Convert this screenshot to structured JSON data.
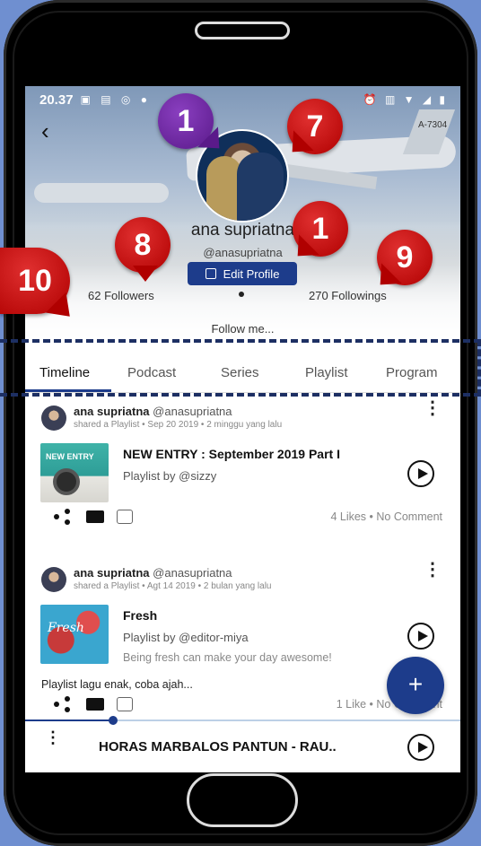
{
  "status_bar": {
    "time": "20.37"
  },
  "profile": {
    "name": "ana supriatna",
    "handle": "@anasupriatna",
    "edit_label": "Edit Profile",
    "followers": "62 Followers",
    "followings": "270 Followings",
    "bio": "Follow me..."
  },
  "cover": {
    "plane_tail_text": "A-7304"
  },
  "tabs": [
    "Timeline",
    "Podcast",
    "Series",
    "Playlist",
    "Program"
  ],
  "timeline": [
    {
      "user": "ana supriatna",
      "handle": "@anasupriatna",
      "meta": "shared a Playlist • Sep 20 2019 • 2 minggu yang lalu",
      "thumb_text": "NEW ENTRY",
      "title": "NEW ENTRY : September 2019 Part I",
      "by": "Playlist by @sizzy",
      "description": "",
      "caption": "",
      "stats": "4 Likes • No Comment"
    },
    {
      "user": "ana supriatna",
      "handle": "@anasupriatna",
      "meta": "shared a Playlist • Agt 14 2019 • 2 bulan yang lalu",
      "thumb_text": "Fresh",
      "title": "Fresh",
      "by": "Playlist by @editor-miya",
      "description": "Being fresh can make your day awesome!",
      "caption": "Playlist lagu enak, coba ajah...",
      "stats": "1 Like • No Comment"
    }
  ],
  "player": {
    "title": "HORAS MARBALOS PANTUN - RAU.."
  },
  "fab": {
    "label": "+"
  },
  "annotations": [
    "1",
    "7",
    "1",
    "8",
    "9",
    "10"
  ],
  "colors": {
    "accent": "#1d3c8b",
    "badge_red": "#c00000",
    "badge_purple": "#6a2aa0",
    "background": "#6f8fd0"
  }
}
